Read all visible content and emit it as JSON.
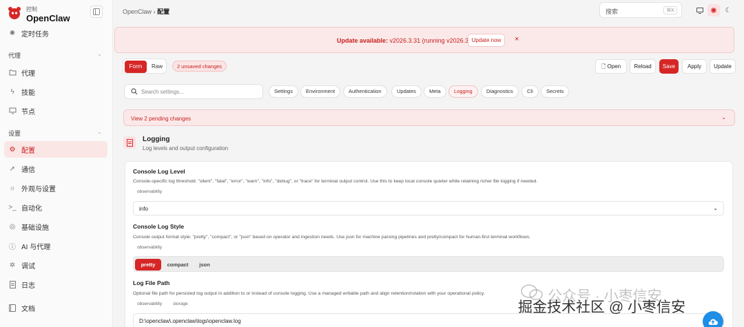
{
  "brand": {
    "subtitle": "控制",
    "name": "OpenClaw"
  },
  "sidebar": {
    "top_item": "定时任务",
    "group1_label": "代理",
    "group1_items": [
      "代理",
      "技能",
      "节点"
    ],
    "group2_label": "设置",
    "group2_items": [
      "配置",
      "通信",
      "外观与设置",
      "自动化",
      "基础设施",
      "AI 与代理",
      "调试",
      "日志"
    ],
    "bottom_item": "文档"
  },
  "breadcrumb": {
    "root": "OpenClaw",
    "separator": "›",
    "current": "配置"
  },
  "top_search": {
    "placeholder": "搜索",
    "shortcut": "⌘K"
  },
  "banner": {
    "label": "Update available:",
    "version": "v2026.3.31 (running v2026.3.28).",
    "button": "Update now",
    "close": "×"
  },
  "toolbar": {
    "mode_form": "Form",
    "mode_raw": "Raw",
    "unsaved": "2 unsaved changes",
    "open": "Open",
    "reload": "Reload",
    "save": "Save",
    "apply": "Apply",
    "update": "Update"
  },
  "settings_search": {
    "placeholder": "Search settings..."
  },
  "chips": [
    "Settings",
    "Environment",
    "Authentication",
    "Updates",
    "Meta",
    "Logging",
    "Diagnostics",
    "Cli",
    "Secrets"
  ],
  "active_chip": "Logging",
  "pending": "View 2 pending changes",
  "section": {
    "title": "Logging",
    "subtitle": "Log levels and output configuration"
  },
  "fields": {
    "console_level": {
      "title": "Console Log Level",
      "desc": "Console-specific log threshold: \"silent\", \"fatal\", \"error\", \"warn\", \"info\", \"debug\", or \"trace\" for terminal output control. Use this to keep local console quieter while retaining richer file logging if needed.",
      "tag": "observability",
      "value": "info"
    },
    "console_style": {
      "title": "Console Log Style",
      "desc": "Console output format style: \"pretty\", \"compact\", or \"json\" based on operator and ingestion needs. Use json for machine parsing pipelines and pretty/compact for human-first terminal workflows.",
      "tag": "observability",
      "options": [
        "pretty",
        "compact",
        "json"
      ],
      "selected": "pretty"
    },
    "file_path": {
      "title": "Log File Path",
      "desc": "Optional file path for persisted log output in addition to or instead of console logging. Use a managed writable path and align retention/rotation with your operational policy.",
      "tags": [
        "observability",
        "storage"
      ],
      "value": "D:\\openclaw\\.openclaw\\logs\\openclaw.log"
    }
  },
  "watermark": {
    "line1": "公众号 · 小枣信安",
    "line2": "掘金技术社区 @ 小枣信安"
  },
  "colors": {
    "accent": "#d62626",
    "accent_bg": "#fbe9e9",
    "fab": "#1f8ee6"
  }
}
